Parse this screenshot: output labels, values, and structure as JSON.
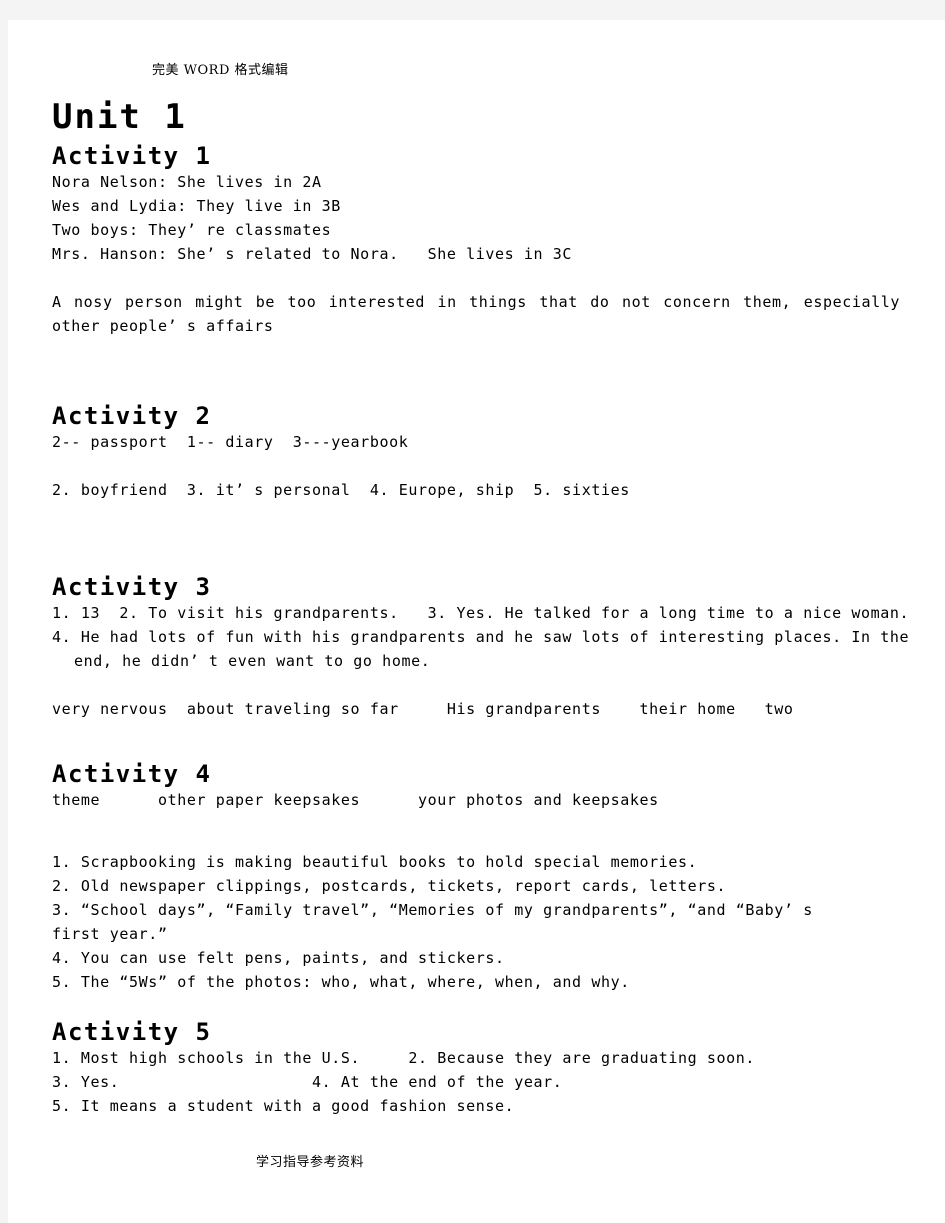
{
  "page": {
    "header": {
      "prefix_cn": "完美 ",
      "latin": "WORD",
      "suffix_cn": " 格式编辑"
    },
    "footer": "学习指导参考资料",
    "unit_title": "Unit 1"
  },
  "activities": [
    {
      "title": "Activity 1",
      "lines": [
        "Nora Nelson: She lives in 2A",
        "Wes and Lydia: They live in 3B",
        "Two boys: They’ re classmates",
        "Mrs. Hanson: She’ s related to Nora.   She lives in 3C"
      ],
      "paragraph": "A nosy person might be too interested in things that do not concern them, especially other people’ s affairs"
    },
    {
      "title": "Activity 2",
      "lines": [
        "2-- passport  1-- diary  3---yearbook"
      ],
      "lines2": [
        "2. boyfriend  3. it’ s personal  4. Europe, ship  5. sixties"
      ]
    },
    {
      "title": "Activity 3",
      "lines": [
        "1. 13  2. To visit his grandparents.   3. Yes. He talked for a long time to a nice woman."
      ],
      "wrapped": "4. He had lots of fun with his grandparents and he saw lots of interesting places. In the",
      "wrapped_cont": "end, he didn’ t even want to go home.",
      "lines2": [
        "very nervous  about traveling so far     His grandparents    their home   two"
      ]
    },
    {
      "title": "Activity 4",
      "lines": [
        "theme      other paper keepsakes      your photos and keepsakes"
      ],
      "items": [
        "1. Scrapbooking is making beautiful books to hold special memories.",
        "2. Old newspaper clippings, postcards, tickets, report cards, letters."
      ],
      "item3": "3. “School days”, “Family travel”, “Memories of my grandparents”, “and “Baby’ s",
      "item3_cont": "first year.”",
      "items_after": [
        "4. You can use felt pens, paints, and stickers.",
        "5. The “5Ws” of the photos: who, what, where, when, and why."
      ]
    },
    {
      "title": "Activity 5",
      "lines": [
        "1. Most high schools in the U.S.     2. Because they are graduating soon.",
        "3. Yes.                    4. At the end of the year.",
        "5. It means a student with a good fashion sense."
      ]
    }
  ],
  "colors": {
    "page_background": "#ffffff",
    "canvas_background": "#f4f4f4",
    "text": "#000000"
  }
}
